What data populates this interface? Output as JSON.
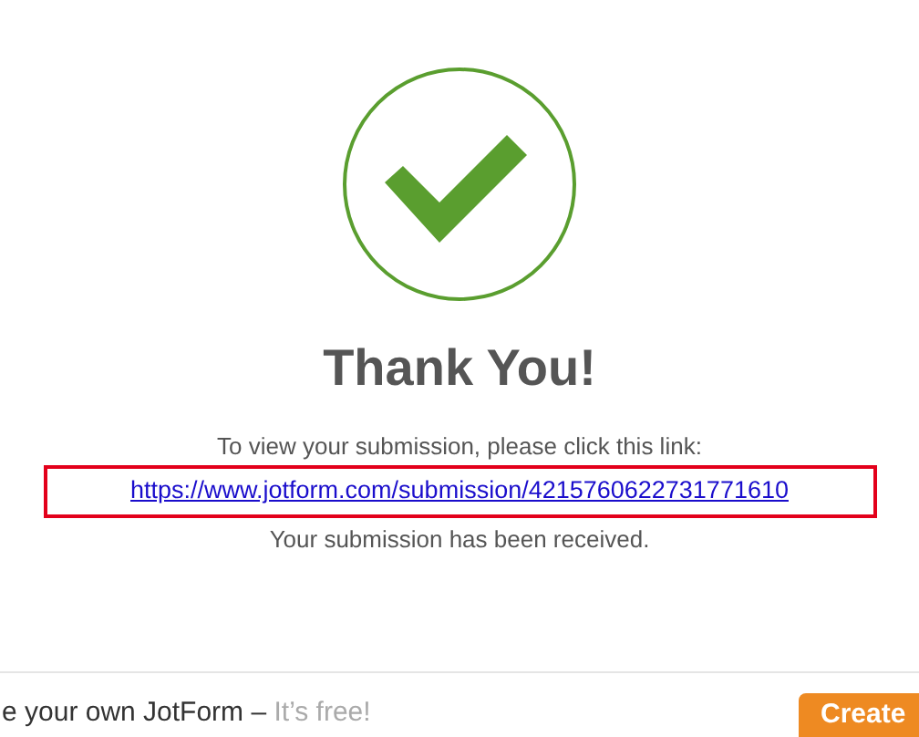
{
  "heading": "Thank You!",
  "instruction": "To view your submission, please click this link:",
  "submission_link": "https://www.jotform.com/submission/4215760622731771610",
  "confirmation": "Your submission has been received.",
  "footer": {
    "promo": "e your own JotForm –",
    "promo_free": "It’s free!",
    "button": "Create"
  }
}
